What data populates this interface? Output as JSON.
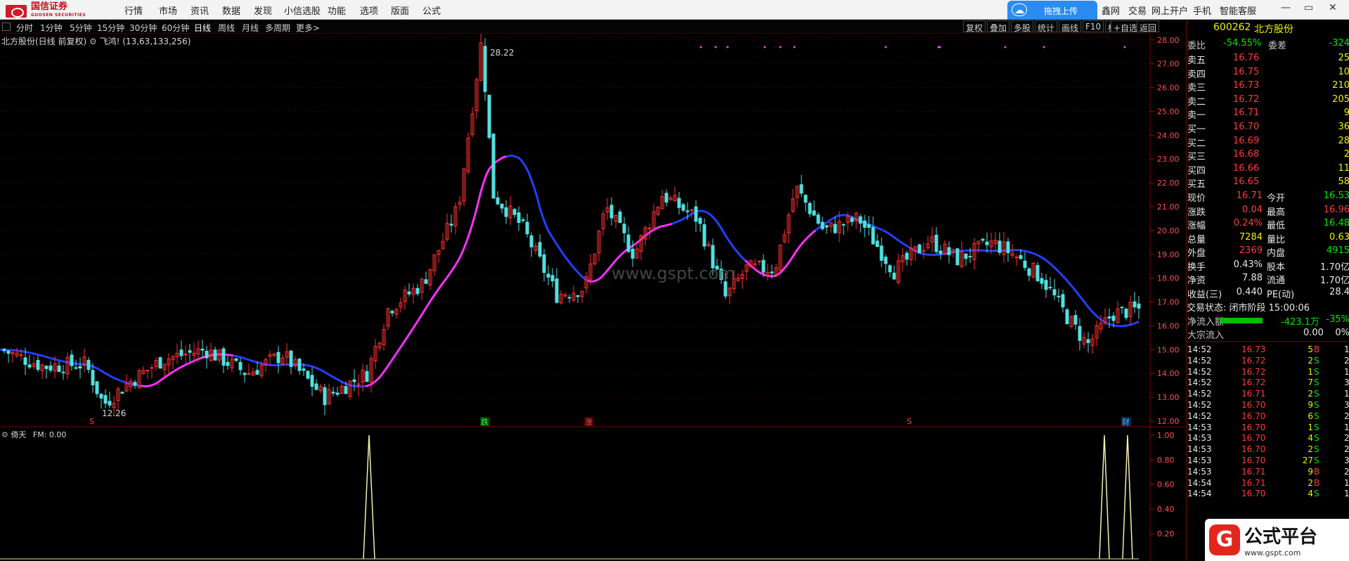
{
  "menubar": {
    "logo_text": "国信证券",
    "logo_sub": "GUOSEN SECURITIES",
    "items": [
      "行情",
      "市场",
      "资讯",
      "数据",
      "发现",
      "小信选股",
      "功能",
      "选项",
      "版面",
      "公式"
    ],
    "upload_label": "拖拽上传",
    "right_items": [
      "鑫网",
      "交易",
      "网上开户",
      "手机",
      "智能客服"
    ],
    "win_controls": [
      "—",
      "▭",
      "✕"
    ]
  },
  "toolbar": {
    "periods": [
      "分时",
      "1分钟",
      "5分钟",
      "15分钟",
      "30分钟",
      "60分钟",
      "日线",
      "周线",
      "月线",
      "多周期",
      "更多>"
    ],
    "active": "日线",
    "right": [
      "复权",
      "叠加",
      "多股",
      "统计",
      "画线",
      "F10",
      "标记",
      "+自选",
      "返回"
    ]
  },
  "chart": {
    "title": "北方股份(日线 前复权)",
    "indicator_name": "飞鸿!",
    "indicator_params": "(13,63,133,256)",
    "high_label": "28.22",
    "low_label": "12.26",
    "price_axis": [
      "28.00",
      "27.00",
      "26.00",
      "25.00",
      "24.00",
      "23.00",
      "22.00",
      "21.00",
      "20.00",
      "19.00",
      "18.00",
      "17.00",
      "16.00",
      "15.00",
      "14.00",
      "13.00",
      "12.00"
    ],
    "markers": {
      "sell": "S",
      "die": "跌",
      "zhang": "涨",
      "cai": "财"
    },
    "watermark": "www.gspt.com"
  },
  "indicator": {
    "title": "倚天",
    "fm": "FM: 0.00",
    "axis": [
      "1.00",
      "0.80",
      "0.60",
      "0.40",
      "0.20"
    ]
  },
  "chart_data": {
    "type": "line",
    "price_range": [
      12.0,
      28.2
    ],
    "signal_range": [
      0,
      1
    ],
    "signal_peaks": [
      {
        "bar_index": "entry",
        "value": 1.0
      },
      {
        "bar_index": "late-1",
        "value": 1.0
      },
      {
        "bar_index": "late-2",
        "value": 1.0
      }
    ]
  },
  "quote": {
    "code": "600262",
    "name": "北方股份",
    "weibi_label": "委比",
    "weibi": "-54.55%",
    "weicha_label": "委差",
    "weicha": "-324",
    "asks": [
      [
        "卖五",
        "16.76",
        "25"
      ],
      [
        "卖四",
        "16.75",
        "10"
      ],
      [
        "卖三",
        "16.73",
        "210"
      ],
      [
        "卖二",
        "16.72",
        "205"
      ],
      [
        "卖一",
        "16.71",
        "9"
      ]
    ],
    "bids": [
      [
        "买一",
        "16.70",
        "36"
      ],
      [
        "买二",
        "16.69",
        "28"
      ],
      [
        "买三",
        "16.68",
        "2"
      ],
      [
        "买四",
        "16.66",
        "11"
      ],
      [
        "买五",
        "16.65",
        "58"
      ]
    ],
    "stats": [
      [
        "现价",
        "16.71",
        "今开",
        "16.53"
      ],
      [
        "涨跌",
        "0.04",
        "最高",
        "16.96"
      ],
      [
        "涨幅",
        "0.24%",
        "最低",
        "16.48"
      ],
      [
        "总量",
        "7284",
        "量比",
        "0.63"
      ],
      [
        "外盘",
        "2369",
        "内盘",
        "4915"
      ],
      [
        "换手",
        "0.43%",
        "股本",
        "1.70亿"
      ],
      [
        "净资",
        "7.88",
        "流通",
        "1.70亿"
      ],
      [
        "收益(三)",
        "0.440",
        "PE(动)",
        "28.4"
      ]
    ],
    "status": "交易状态: 闭市阶段 15:00:06",
    "net_inflow_label": "净流入额",
    "net_inflow": "-423.1万",
    "net_inflow_pct": "-35%",
    "block_label": "大宗流入",
    "block": "0.00",
    "block_pct": "0%",
    "ticks": [
      [
        "14:52",
        "16.73",
        "5",
        "B",
        "1"
      ],
      [
        "14:52",
        "16.72",
        "2",
        "S",
        "2"
      ],
      [
        "14:52",
        "16.72",
        "1",
        "S",
        "1"
      ],
      [
        "14:52",
        "16.72",
        "7",
        "S",
        "3"
      ],
      [
        "14:52",
        "16.71",
        "2",
        "S",
        "1"
      ],
      [
        "14:52",
        "16.70",
        "9",
        "S",
        "3"
      ],
      [
        "14:52",
        "16.70",
        "6",
        "S",
        "2"
      ],
      [
        "14:53",
        "16.70",
        "1",
        "S",
        "1"
      ],
      [
        "14:53",
        "16.70",
        "4",
        "S",
        "2"
      ],
      [
        "14:53",
        "16.70",
        "2",
        "S",
        "2"
      ],
      [
        "14:53",
        "16.70",
        "27",
        "S",
        "3"
      ],
      [
        "14:53",
        "16.71",
        "9",
        "B",
        "2"
      ],
      [
        "14:54",
        "16.71",
        "2",
        "B",
        "1"
      ],
      [
        "14:54",
        "16.70",
        "4",
        "S",
        "1"
      ]
    ]
  },
  "badge": {
    "title": "公式平台",
    "url": "www.gspt.com",
    "letter": "G"
  }
}
